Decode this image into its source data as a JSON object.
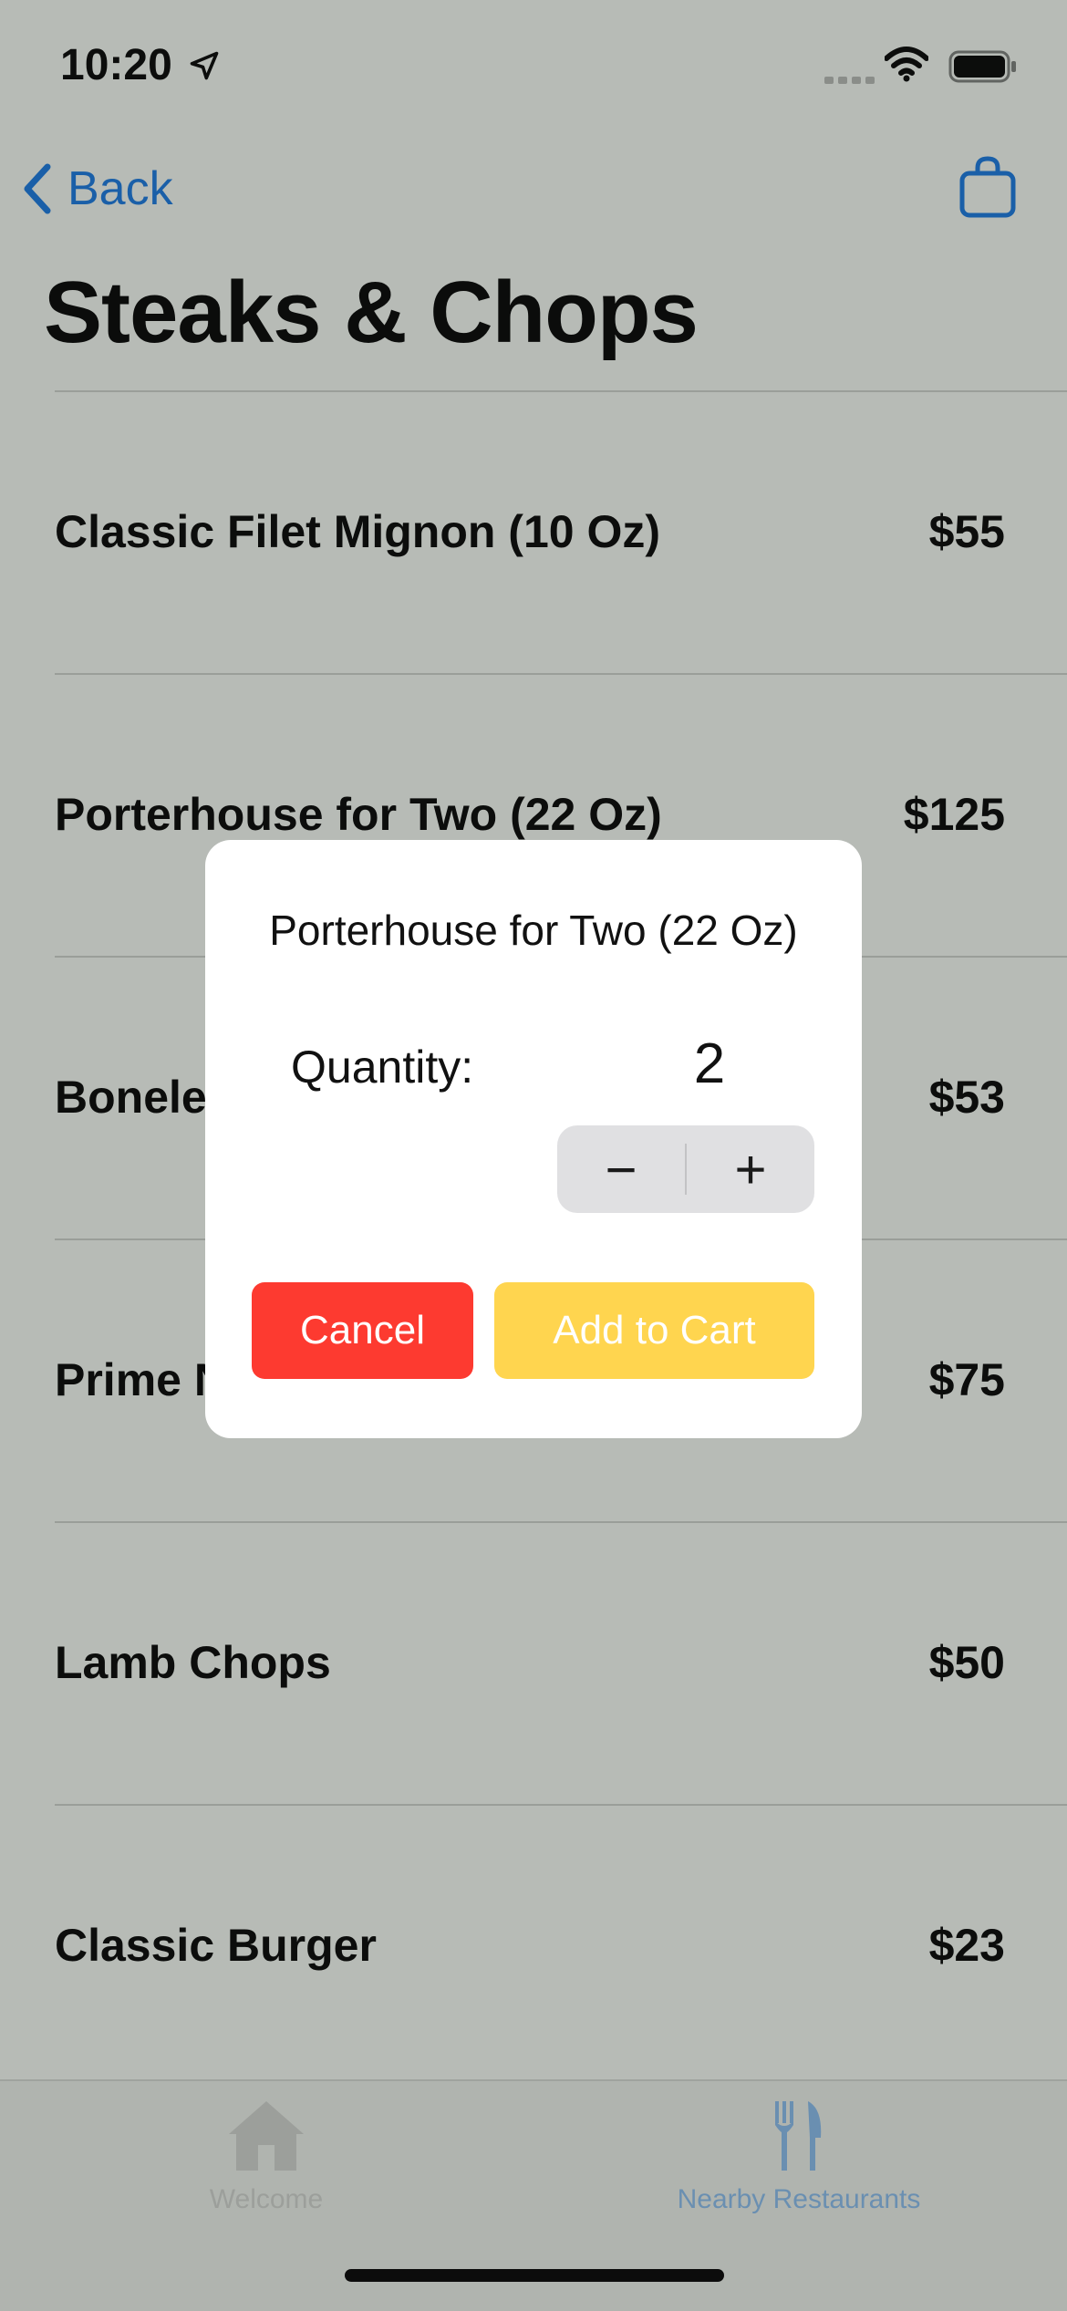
{
  "status_bar": {
    "time": "10:20"
  },
  "nav": {
    "back_label": "Back",
    "title": "Steaks & Chops"
  },
  "menu_items": [
    {
      "name": "Classic Filet Mignon (10 Oz)",
      "price": "$55"
    },
    {
      "name": "Porterhouse for Two (22 Oz)",
      "price": "$125"
    },
    {
      "name": "Boneless Ribeye",
      "price": "$53"
    },
    {
      "name": "Prime NY Strip",
      "price": "$75"
    },
    {
      "name": "Lamb Chops",
      "price": "$50"
    },
    {
      "name": "Classic Burger",
      "price": "$23"
    }
  ],
  "dialog": {
    "title": "Porterhouse for Two (22 Oz)",
    "quantity_label": "Quantity:",
    "quantity": "2",
    "minus": "−",
    "plus": "+",
    "cancel_label": "Cancel",
    "add_label": "Add to Cart"
  },
  "tabs": [
    {
      "label": "Welcome",
      "icon": "home-icon"
    },
    {
      "label": "Nearby Restaurants",
      "icon": "fork-knife-icon"
    }
  ],
  "colors": {
    "accent": "#1a5fa8",
    "cancel": "#fd3a30",
    "add_to_cart": "#ffd54f"
  }
}
